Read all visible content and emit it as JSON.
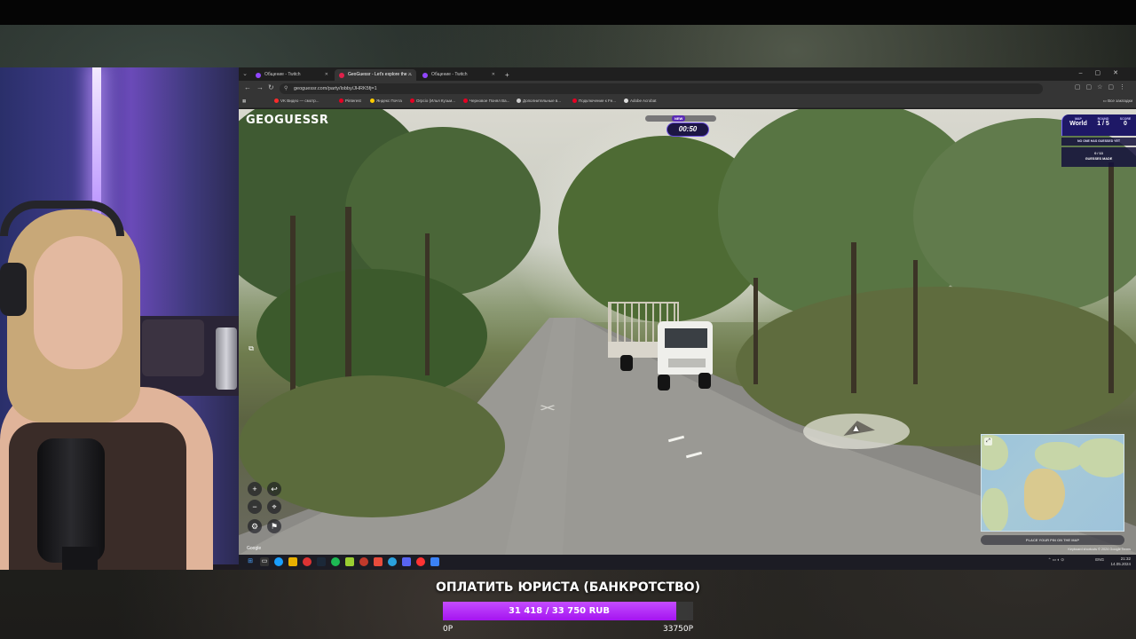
{
  "browser": {
    "tabs": [
      {
        "label": "Общение - Twitch",
        "icon": "twitch-icon",
        "active": false
      },
      {
        "label": "GeoGuessr - Let's explore the ...",
        "icon": "geoguessr-icon",
        "active": true
      },
      {
        "label": "Общение - Twitch",
        "icon": "twitch-icon",
        "active": false
      }
    ],
    "url": "geoguessr.com/party/lobby/JHRK5fj=1",
    "bookmarks": [
      {
        "label": "VK Видео — смотр...",
        "color": "#ff2b2b"
      },
      {
        "label": "Pinterest",
        "color": "#e60023"
      },
      {
        "label": "Яндекс Почта",
        "color": "#ffcc00"
      },
      {
        "label": "Orpcio (Илья Кузьм...",
        "color": "#e60023"
      },
      {
        "label": "Черновое Понял Ва...",
        "color": "#e60023"
      },
      {
        "label": "Дополнительные в...",
        "color": "#cccccc"
      },
      {
        "label": "Подключение к Fe...",
        "color": "#e60023"
      },
      {
        "label": "Adobe Acrobat",
        "color": "#dddddd"
      }
    ],
    "bookmarks_right": "Все закладки"
  },
  "game": {
    "logo": "GEOGUESSR",
    "timer_tag": "NEW",
    "timer": "00:50",
    "status": {
      "map_label": "MAP",
      "map_value": "World",
      "round_label": "ROUND",
      "round_value": "1 / 5",
      "score_label": "SCORE",
      "score_value": "0",
      "no_guess": "NO ONE HAS GUESSED YET",
      "guesses_count": "0 / 13",
      "guesses_label": "GUESSES MADE"
    },
    "guess_button": "PLACE YOUR PIN ON THE MAP",
    "footer_left": "Google",
    "footer_right": "Keyboard shortcuts   © 2024 Google   Terms"
  },
  "taskbar": {
    "lang": "ENG",
    "time": "21:32",
    "date": "14.05.2024"
  },
  "goal": {
    "title": "ОПЛАТИТЬ ЮРИСТА (БАНКРОТСТВО)",
    "amount_text": "31 418 / 33 750 RUB",
    "current": 31418,
    "target": 33750,
    "min_label": "0Р",
    "max_label": "33750Р"
  }
}
